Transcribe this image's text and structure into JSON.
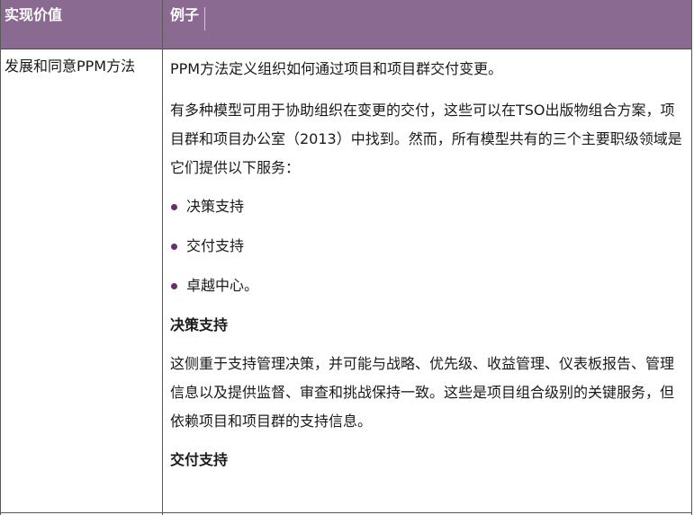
{
  "table": {
    "headers": {
      "col1": "实现价值",
      "col2": "例子"
    },
    "row": {
      "col1": "发展和同意PPM方法",
      "col2": {
        "para1": "PPM方法定义组织如何通过项目和项目群交付变更。",
        "para2": "有多种模型可用于协助组织在变更的交付，这些可以在TSO出版物组合方案，项目群和项目办公室（2013）中找到。然而，所有模型共有的三个主要职级领域是它们提供以下服务：",
        "bullets": [
          "决策支持",
          "交付支持",
          "卓越中心。"
        ],
        "heading1": "决策支持",
        "para3": "这侧重于支持管理决策，并可能与战略、优先级、收益管理、仪表板报告、管理信息以及提供监督、审查和挑战保持一致。这些是项目组合级别的关键服务，但依赖项目和项目群的支持信息。",
        "heading2": "交付支持"
      }
    }
  },
  "colors": {
    "header_bg": "#8b6a91",
    "header_text": "#ffffff",
    "bullet": "#6b2c6d",
    "border": "#5a5a5a"
  }
}
